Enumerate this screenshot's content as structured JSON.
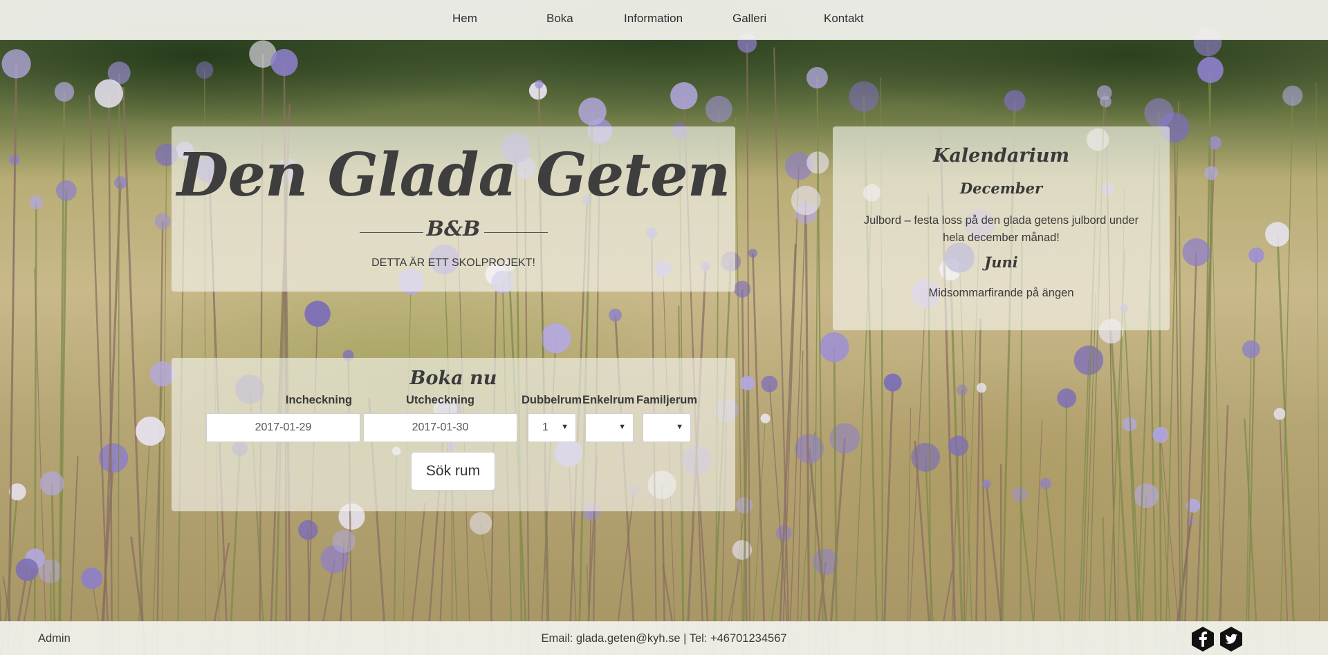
{
  "nav": {
    "items": [
      "Hem",
      "Boka",
      "Information",
      "Galleri",
      "Kontakt"
    ]
  },
  "hero": {
    "title": "Den Glada Geten",
    "subtitle": "B&B",
    "note": "DETTA ÄR ETT SKOLPROJEKT!"
  },
  "calendar": {
    "title": "Kalendarium",
    "entries": [
      {
        "month": "December",
        "text": "Julbord – festa loss på den glada getens julbord under hela december månad!"
      },
      {
        "month": "Juni",
        "text": "Midsommarfirande på ängen"
      }
    ]
  },
  "booking": {
    "title": "Boka nu",
    "checkin_label": "Incheckning",
    "checkin_value": "2017-01-29",
    "checkout_label": "Utcheckning",
    "checkout_value": "2017-01-30",
    "double_label": "Dubbelrum",
    "double_value": "1",
    "single_label": "Enkelrum",
    "single_value": "",
    "family_label": "Familjerum",
    "family_value": "",
    "search_label": "Sök rum"
  },
  "footer": {
    "admin": "Admin",
    "contact": "Email: glada.geten@kyh.se | Tel: +46701234567",
    "social": [
      "facebook-icon",
      "twitter-icon"
    ]
  },
  "colors": {
    "text": "#3a3a3a",
    "panel": "#f5f5f0",
    "flower": "#8d7fc9",
    "meadow": "#b8ad76"
  }
}
